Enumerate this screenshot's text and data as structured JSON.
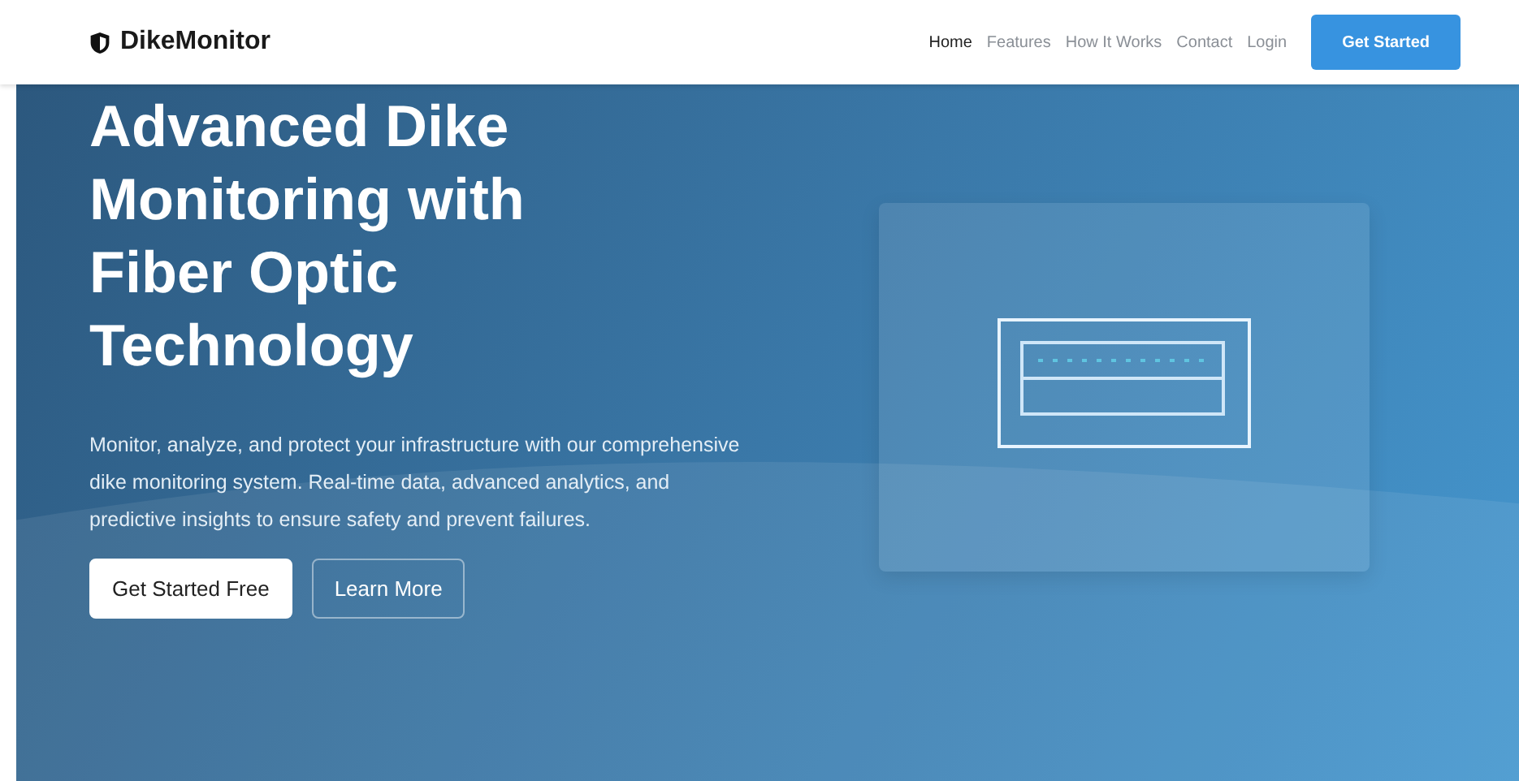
{
  "brand": {
    "name": "DikeMonitor"
  },
  "nav": {
    "links": [
      {
        "label": "Home",
        "selected": true
      },
      {
        "label": "Features",
        "selected": false
      },
      {
        "label": "How It Works",
        "selected": false
      },
      {
        "label": "Contact",
        "selected": false
      },
      {
        "label": "Login",
        "selected": false
      }
    ],
    "cta": "Get Started"
  },
  "hero": {
    "title": "Advanced Dike Monitoring with Fiber Optic Technology",
    "text": "Monitor, analyze, and protect your infrastructure with our comprehensive dike monitoring system. Real-time data, advanced analytics, and predictive insights to ensure safety and prevent failures.",
    "buttons": [
      {
        "label": "Get Started Free",
        "kind": "primary"
      },
      {
        "label": "Learn More",
        "kind": "outline"
      }
    ]
  }
}
